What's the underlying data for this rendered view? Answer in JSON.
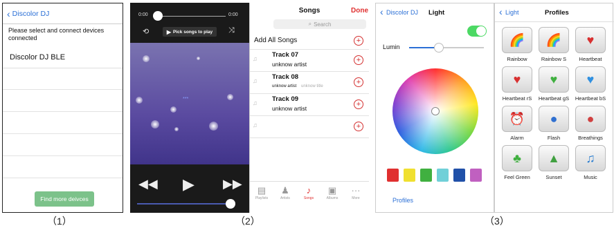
{
  "panel1": {
    "back": "Discolor DJ",
    "prompt": "Please select and connect devices connected",
    "device": "Discolor DJ BLE",
    "button": "Find more deivces",
    "caption": "（1）"
  },
  "player": {
    "time_start": "0:00",
    "time_end": "0:00",
    "pick": "Pick songs to play",
    "art_text": "***"
  },
  "songs": {
    "title": "Songs",
    "done": "Done",
    "search": "Search",
    "add_all": "Add All Songs",
    "tracks": [
      {
        "title": "Track 07",
        "artist": "unknow artist",
        "album": ""
      },
      {
        "title": "Track 08",
        "artist": "unknow artist",
        "album": "unknow title"
      },
      {
        "title": "Track 09",
        "artist": "unknow artist",
        "album": ""
      }
    ],
    "tabs": [
      "Playlists",
      "Artists",
      "Songs",
      "Albums",
      "More"
    ],
    "caption": "（2）"
  },
  "light": {
    "back": "Discolor DJ",
    "title": "Light",
    "lumin": "Lumin",
    "profiles": "Profiles",
    "toggle_on": true,
    "swatches": [
      "#e03030",
      "#f0e030",
      "#40b040",
      "#70d0d8",
      "#2050a8",
      "#c060c0"
    ],
    "caption": "（3）"
  },
  "profiles": {
    "back": "Light",
    "title": "Profiles",
    "items": [
      {
        "label": "Rainbow",
        "icon": "rainbow-icon"
      },
      {
        "label": "Rainbow S",
        "icon": "rainbow-sun-icon"
      },
      {
        "label": "Heartbeat",
        "icon": "heartbeat-icon"
      },
      {
        "label": "Heartbeat rS",
        "icon": "heartbeat-red-icon"
      },
      {
        "label": "Heartbeat gS",
        "icon": "heartbeat-green-icon"
      },
      {
        "label": "Heartbeat bS",
        "icon": "heartbeat-blue-icon"
      },
      {
        "label": "Alarm",
        "icon": "alarm-icon"
      },
      {
        "label": "Flash",
        "icon": "flash-icon"
      },
      {
        "label": "Breathings",
        "icon": "breathing-icon"
      },
      {
        "label": "Feel Green",
        "icon": "feel-green-icon"
      },
      {
        "label": "Sunset",
        "icon": "sunset-icon"
      },
      {
        "label": "Music",
        "icon": "music-icon"
      }
    ]
  }
}
